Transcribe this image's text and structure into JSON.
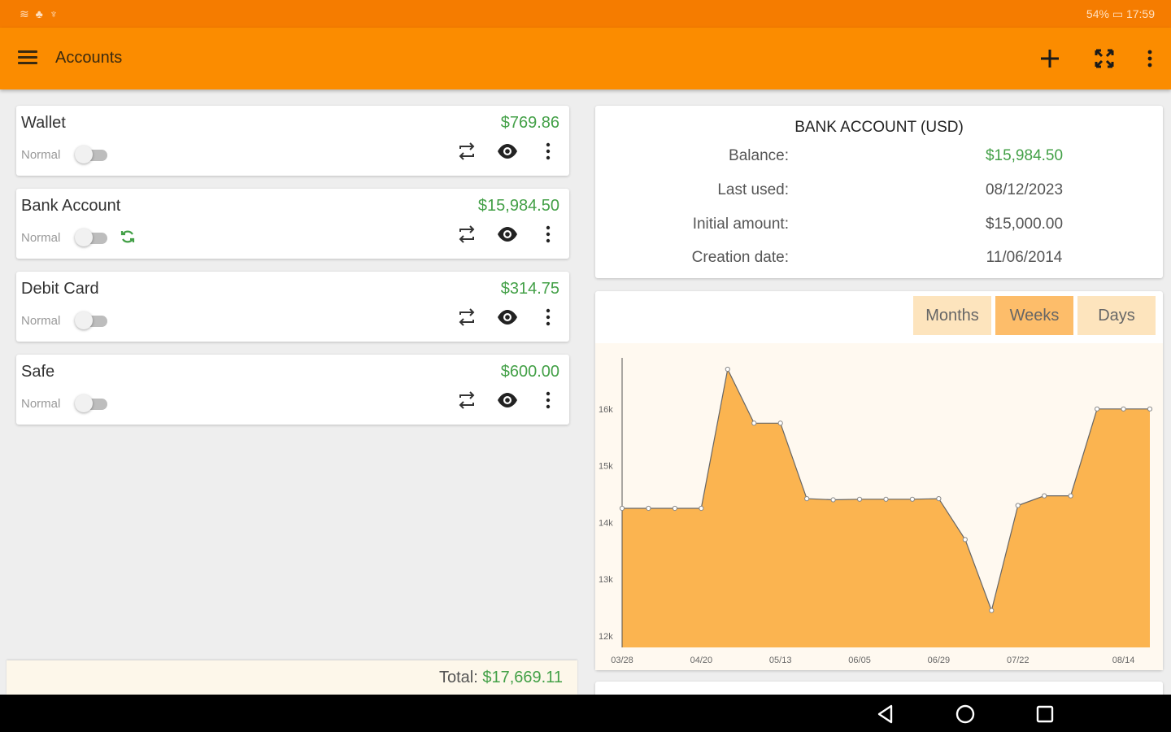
{
  "status_bar": {
    "left_icons": "≋ ♣ ♆",
    "battery": "54%",
    "time": "17:59"
  },
  "app_bar": {
    "title": "Accounts"
  },
  "accounts": [
    {
      "name": "Wallet",
      "amount": "$769.86",
      "mode": "Normal",
      "synced": false
    },
    {
      "name": "Bank Account",
      "amount": "$15,984.50",
      "mode": "Normal",
      "synced": true
    },
    {
      "name": "Debit Card",
      "amount": "$314.75",
      "mode": "Normal",
      "synced": false
    },
    {
      "name": "Safe",
      "amount": "$600.00",
      "mode": "Normal",
      "synced": false
    }
  ],
  "total": {
    "label": "Total:",
    "value": "$17,669.11"
  },
  "details": {
    "heading": "BANK ACCOUNT (USD)",
    "rows": [
      {
        "label": "Balance:",
        "value": "$15,984.50",
        "color": "#43a047"
      },
      {
        "label": "Last used:",
        "value": "08/12/2023"
      },
      {
        "label": "Initial amount:",
        "value": "$15,000.00"
      },
      {
        "label": "Creation date:",
        "value": "11/06/2014"
      }
    ]
  },
  "period_tabs": [
    {
      "label": "Months",
      "selected": false
    },
    {
      "label": "Weeks",
      "selected": true
    },
    {
      "label": "Days",
      "selected": false
    }
  ],
  "colors": {
    "status_bar": "#f57c00",
    "app_bar": "#fb8c00",
    "positive": "#43a047",
    "chart_fill": "#fbb450"
  },
  "chart_data": {
    "type": "area",
    "ylim": [
      11800,
      16900
    ],
    "yticks": [
      {
        "value": 12000,
        "label": "12k"
      },
      {
        "value": 13000,
        "label": "13k"
      },
      {
        "value": 14000,
        "label": "14k"
      },
      {
        "value": 15000,
        "label": "15k"
      },
      {
        "value": 16000,
        "label": "16k"
      }
    ],
    "xticks": [
      {
        "index": 0,
        "label": "03/28"
      },
      {
        "index": 3,
        "label": "04/20"
      },
      {
        "index": 6,
        "label": "05/13"
      },
      {
        "index": 9,
        "label": "06/05"
      },
      {
        "index": 12,
        "label": "06/29"
      },
      {
        "index": 15,
        "label": "07/22"
      },
      {
        "index": 19,
        "label": "08/14"
      }
    ],
    "values": [
      14250,
      14250,
      14250,
      14250,
      16700,
      15750,
      15750,
      14420,
      14400,
      14410,
      14410,
      14410,
      14420,
      13700,
      12450,
      14300,
      14470,
      14470,
      16000,
      16000,
      16000
    ]
  }
}
